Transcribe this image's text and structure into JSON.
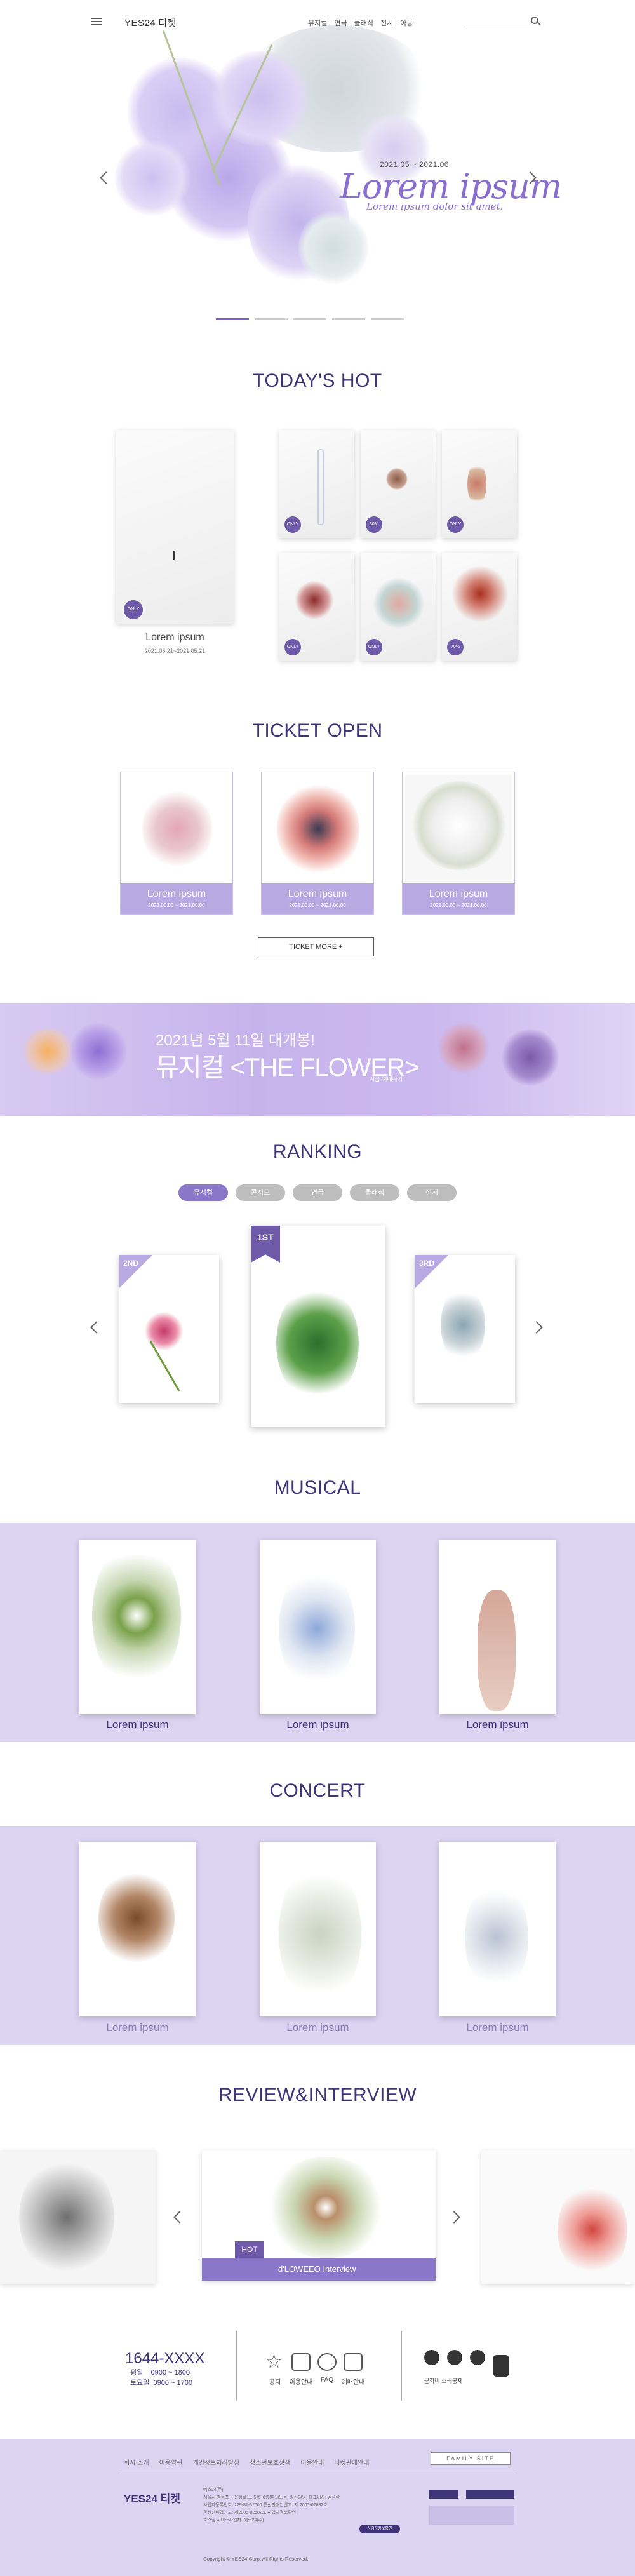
{
  "header": {
    "logo": "YES24",
    "logo_sub": "티켓",
    "nav": [
      "뮤지컬",
      "연극",
      "클래식",
      "전시",
      "아동"
    ]
  },
  "hero": {
    "dates": "2021.05 ~ 2021.06",
    "title": "Lorem ipsum",
    "subtitle": "Lorem ipsum dolor sit amet.",
    "slides": 5,
    "active_slide": 1
  },
  "todays_hot": {
    "title": "TODAY'S HOT",
    "main": {
      "badge": "ONLY",
      "caption": "Lorem ipsum",
      "date": "2021.05.21~2021.05.21"
    },
    "grid_badges": [
      "ONLY",
      "30%",
      "ONLY",
      "ONLY",
      "ONLY",
      "70%"
    ]
  },
  "ticket_open": {
    "title": "TICKET OPEN",
    "cards": [
      {
        "caption": "Lorem ipsum",
        "date": "2021.00.00 ~ 2021.00.00"
      },
      {
        "caption": "Lorem ipsum",
        "date": "2021.00.00 ~ 2021.00.00"
      },
      {
        "caption": "Lorem ipsum",
        "date": "2021.00.00 ~ 2021.00.00"
      }
    ],
    "more": "TICKET MORE +"
  },
  "banner": {
    "line1": "2021년 5월 11일 대개봉!",
    "line2": "뮤지컬 <THE FLOWER>",
    "line3": "지금 예매하기"
  },
  "ranking": {
    "title": "RANKING",
    "tabs": [
      "뮤지컬",
      "콘서트",
      "연극",
      "클래식",
      "전시"
    ],
    "active_tab": 0,
    "cards": [
      "2ND",
      "1ST",
      "3RD"
    ]
  },
  "musical": {
    "title": "MUSICAL",
    "captions": [
      "Lorem ipsum",
      "Lorem ipsum",
      "Lorem ipsum"
    ]
  },
  "concert": {
    "title": "CONCERT",
    "captions": [
      "Lorem ipsum",
      "Lorem ipsum",
      "Lorem ipsum"
    ]
  },
  "review": {
    "title": "REVIEW&INTERVIEW",
    "hot_label": "HOT",
    "caption": "d'LOWEEO Interview"
  },
  "footer": {
    "phone": "1644-XXXX",
    "weekday_label": "평일",
    "weekday_hours": "0900 ~ 1800",
    "saturday_label": "토요일",
    "saturday_hours": "0900 ~ 1700",
    "icons": [
      "공지",
      "이용안내",
      "FAQ",
      "예매안내"
    ],
    "sns_label": "문화비 소득공제",
    "links": [
      "회사 소개",
      "이용약관",
      "개인정보처리방침",
      "청소년보호정책",
      "이용안내",
      "티켓판매안내"
    ],
    "family": "FAMILY SITE",
    "logo": "YES24 티켓",
    "info_title": "예스24(주)",
    "info_lines": [
      "서울시 영등포구 은행로11, 5층~6층(여의도동, 일신빌딩) 대표이사: 김석환",
      "사업자등록번호: 229-81-37000 통신판매업신고: 제 2005-02682호",
      "통신판매업신고: 제2005-02682호 사업자정보확인",
      "호스팅 서비스사업자: 예스24(주)"
    ],
    "info_button": "사업자정보확인",
    "copyright": "Copyright © YES24 Corp. All Rights Reserved."
  },
  "colors": {
    "accent": "#7b62c4",
    "navy": "#3e3478",
    "lavender": "#dcd5f2"
  }
}
